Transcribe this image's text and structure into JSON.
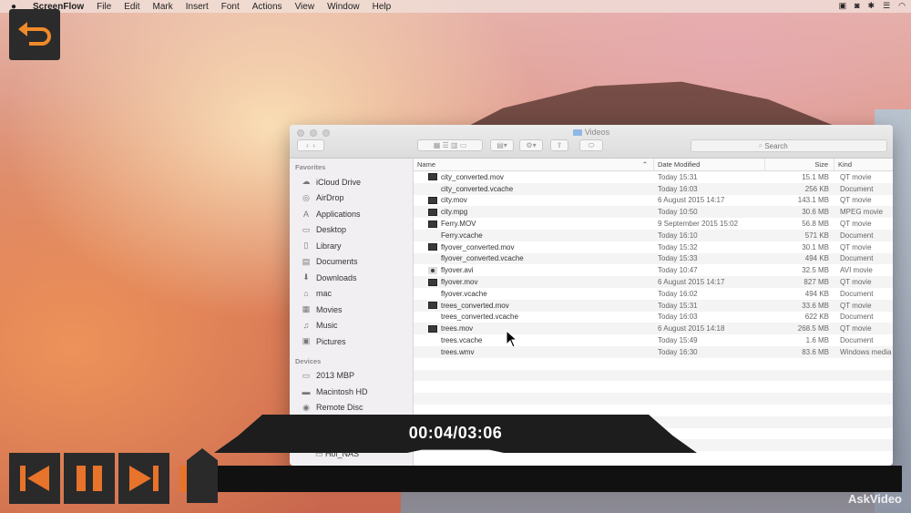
{
  "menubar": {
    "app_name": "ScreenFlow",
    "items": [
      "File",
      "Edit",
      "Mark",
      "Insert",
      "Font",
      "Actions",
      "View",
      "Window",
      "Help"
    ]
  },
  "finder": {
    "title": "Videos",
    "search_placeholder": "Search",
    "sidebar": {
      "favorites_header": "Favorites",
      "favorites": [
        {
          "label": "iCloud Drive",
          "icon": "cloud-icon"
        },
        {
          "label": "AirDrop",
          "icon": "airdrop-icon"
        },
        {
          "label": "Applications",
          "icon": "applications-icon"
        },
        {
          "label": "Desktop",
          "icon": "desktop-icon"
        },
        {
          "label": "Library",
          "icon": "folder-icon"
        },
        {
          "label": "Documents",
          "icon": "documents-icon"
        },
        {
          "label": "Downloads",
          "icon": "downloads-icon"
        },
        {
          "label": "mac",
          "icon": "home-icon"
        },
        {
          "label": "Movies",
          "icon": "movies-icon"
        },
        {
          "label": "Music",
          "icon": "music-icon"
        },
        {
          "label": "Pictures",
          "icon": "pictures-icon"
        }
      ],
      "devices_header": "Devices",
      "devices": [
        {
          "label": "2013 MBP",
          "icon": "laptop-icon"
        },
        {
          "label": "Macintosh HD",
          "icon": "disk-icon"
        },
        {
          "label": "Remote Disc",
          "icon": "disc-icon"
        }
      ],
      "network_item": "Hol_NAS"
    },
    "columns": {
      "name": "Name",
      "date": "Date Modified",
      "size": "Size",
      "kind": "Kind"
    },
    "files": [
      {
        "name": "city_converted.mov",
        "date": "Today 15:31",
        "size": "15.1 MB",
        "kind": "QT movie",
        "type": "movie"
      },
      {
        "name": "city_converted.vcache",
        "date": "Today 16:03",
        "size": "256 KB",
        "kind": "Document",
        "type": "doc"
      },
      {
        "name": "city.mov",
        "date": "6 August 2015 14:17",
        "size": "143.1 MB",
        "kind": "QT movie",
        "type": "movie"
      },
      {
        "name": "city.mpg",
        "date": "Today 10:50",
        "size": "30.6 MB",
        "kind": "MPEG movie",
        "type": "movie"
      },
      {
        "name": "Ferry.MOV",
        "date": "9 September 2015 15:02",
        "size": "56.8 MB",
        "kind": "QT movie",
        "type": "movie"
      },
      {
        "name": "Ferry.vcache",
        "date": "Today 16:10",
        "size": "571 KB",
        "kind": "Document",
        "type": "doc"
      },
      {
        "name": "flyover_converted.mov",
        "date": "Today 15:32",
        "size": "30.1 MB",
        "kind": "QT movie",
        "type": "movie"
      },
      {
        "name": "flyover_converted.vcache",
        "date": "Today 15:33",
        "size": "494 KB",
        "kind": "Document",
        "type": "doc"
      },
      {
        "name": "flyover.avi",
        "date": "Today 10:47",
        "size": "32.5 MB",
        "kind": "AVI movie",
        "type": "avi"
      },
      {
        "name": "flyover.mov",
        "date": "6 August 2015 14:17",
        "size": "827 MB",
        "kind": "QT movie",
        "type": "movie"
      },
      {
        "name": "flyover.vcache",
        "date": "Today 16:02",
        "size": "494 KB",
        "kind": "Document",
        "type": "doc"
      },
      {
        "name": "trees_converted.mov",
        "date": "Today 15:31",
        "size": "33.6 MB",
        "kind": "QT movie",
        "type": "movie"
      },
      {
        "name": "trees_converted.vcache",
        "date": "Today 16:03",
        "size": "622 KB",
        "kind": "Document",
        "type": "doc"
      },
      {
        "name": "trees.mov",
        "date": "6 August 2015 14:18",
        "size": "268.5 MB",
        "kind": "QT movie",
        "type": "movie"
      },
      {
        "name": "trees.vcache",
        "date": "Today 15:49",
        "size": "1.6 MB",
        "kind": "Document",
        "type": "doc"
      },
      {
        "name": "trees.wmv",
        "date": "Today 16:30",
        "size": "83.6 MB",
        "kind": "Windows media",
        "type": "doc"
      }
    ]
  },
  "player": {
    "timecode": "00:04/03:06",
    "progress_fraction": 0.013,
    "accent_color": "#e8732a",
    "watermark": "AskVideo"
  }
}
